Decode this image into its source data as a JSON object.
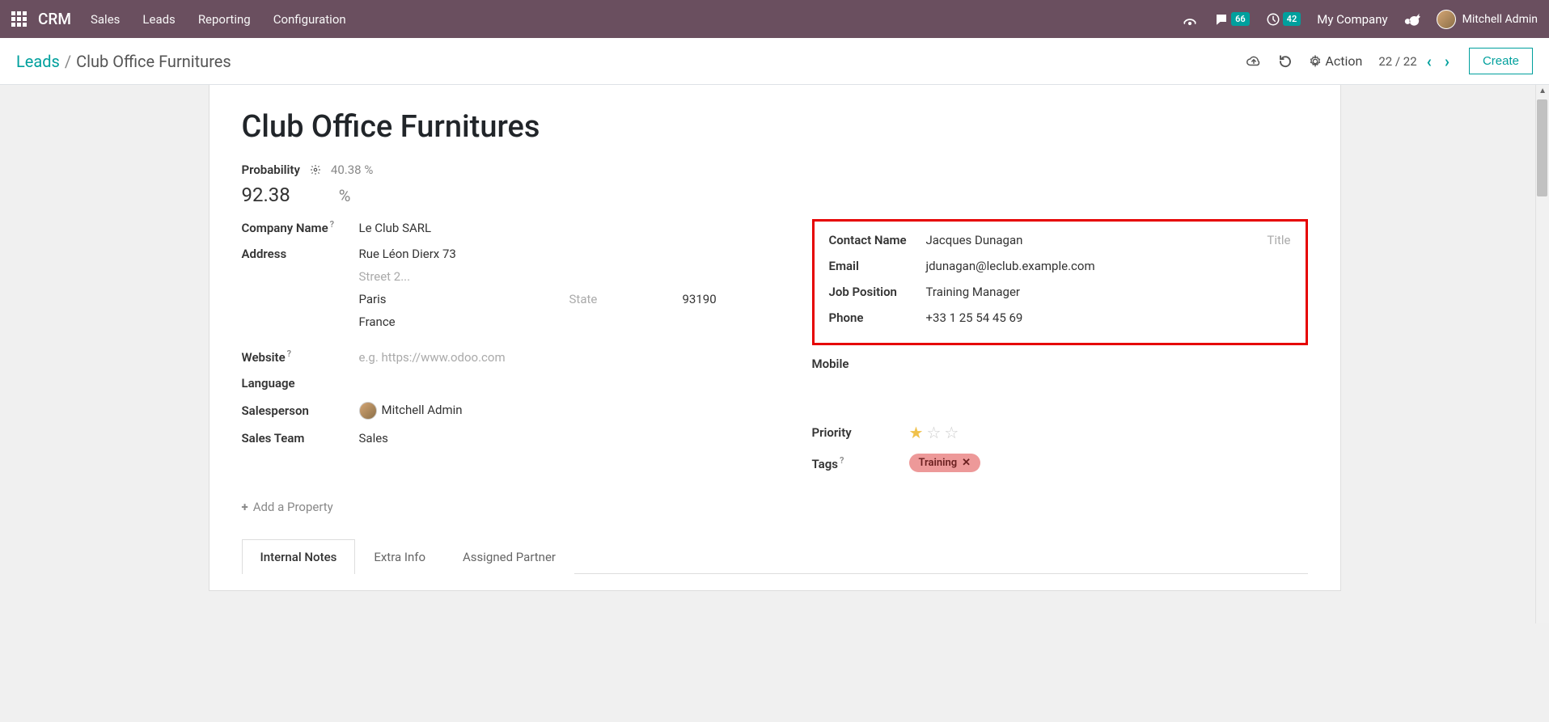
{
  "topbar": {
    "brand": "CRM",
    "menu": [
      "Sales",
      "Leads",
      "Reporting",
      "Configuration"
    ],
    "messages_badge": "66",
    "activities_badge": "42",
    "company": "My Company",
    "user": "Mitchell Admin"
  },
  "controlbar": {
    "breadcrumb_root": "Leads",
    "breadcrumb_current": "Club Office Furnitures",
    "action_label": "Action",
    "pager": "22 / 22",
    "create": "Create"
  },
  "form": {
    "title": "Club Office Furnitures",
    "probability_label": "Probability",
    "probability_hint": "40.38 %",
    "probability_value": "92.38",
    "percent_sign": "%",
    "company_name_label": "Company Name",
    "company_name": "Le Club SARL",
    "address_label": "Address",
    "street1": "Rue Léon Dierx 73",
    "street2_ph": "Street 2...",
    "city": "Paris",
    "state_ph": "State",
    "zip": "93190",
    "country": "France",
    "website_label": "Website",
    "website_ph": "e.g. https://www.odoo.com",
    "language_label": "Language",
    "salesperson_label": "Salesperson",
    "salesperson": "Mitchell Admin",
    "salesteam_label": "Sales Team",
    "salesteam": "Sales",
    "contact_name_label": "Contact Name",
    "contact_name": "Jacques Dunagan",
    "title_ph": "Title",
    "email_label": "Email",
    "email": "jdunagan@leclub.example.com",
    "job_label": "Job Position",
    "job": "Training Manager",
    "phone_label": "Phone",
    "phone": "+33 1 25 54 45 69",
    "mobile_label": "Mobile",
    "priority_label": "Priority",
    "tags_label": "Tags",
    "tag1": "Training",
    "add_property": "Add a Property"
  },
  "tabs": {
    "t1": "Internal Notes",
    "t2": "Extra Info",
    "t3": "Assigned Partner"
  }
}
